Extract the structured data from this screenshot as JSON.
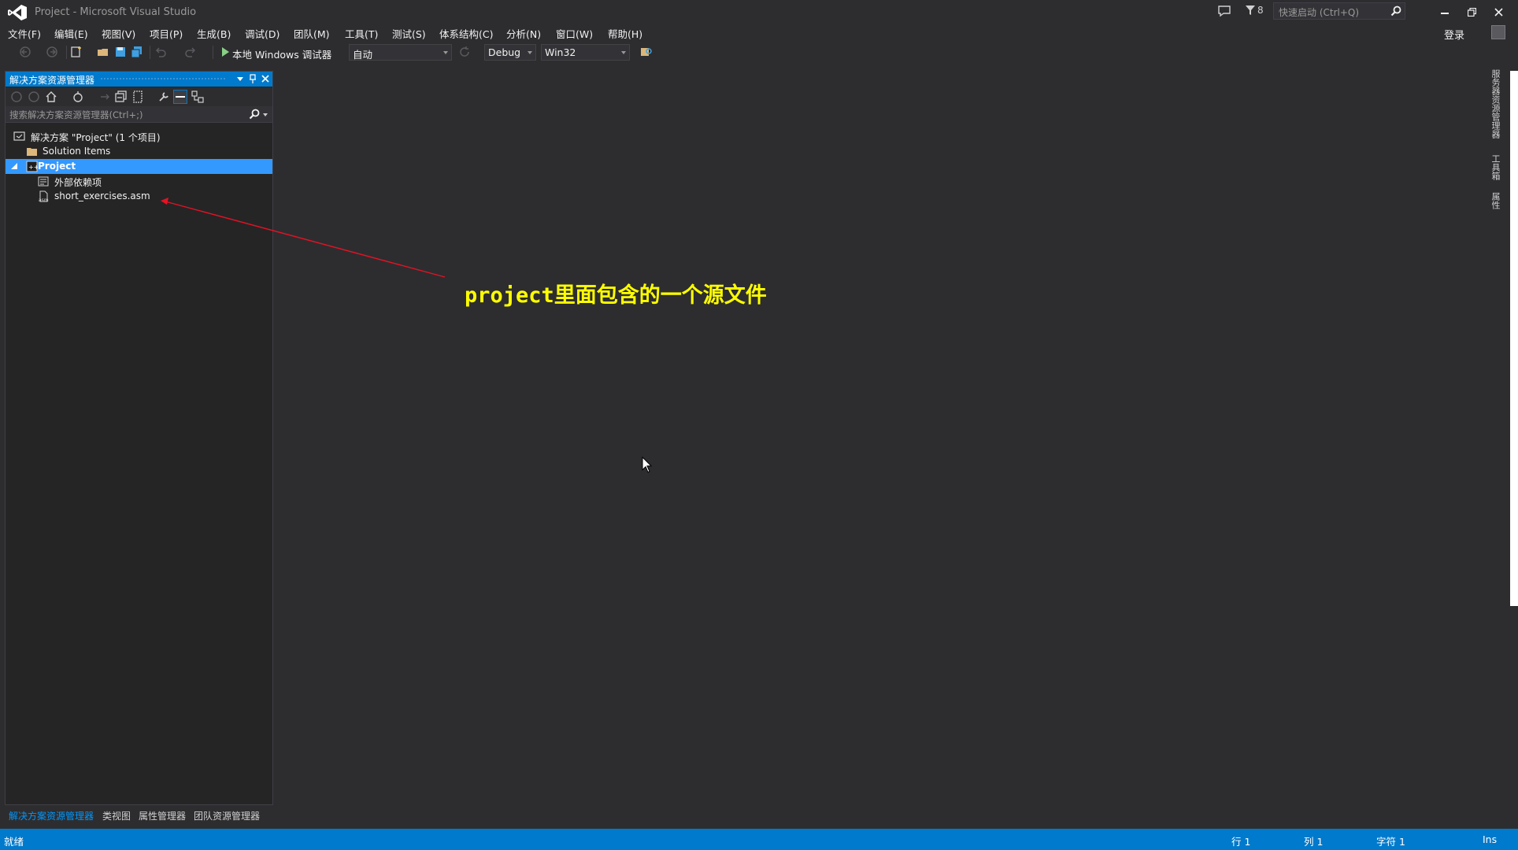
{
  "window": {
    "title": "Project - Microsoft Visual Studio",
    "notification_count": "8",
    "quick_launch_placeholder": "快速启动 (Ctrl+Q)",
    "signin_label": "登录"
  },
  "menu": {
    "items": [
      "文件(F)",
      "编辑(E)",
      "视图(V)",
      "项目(P)",
      "生成(B)",
      "调试(D)",
      "团队(M)",
      "工具(T)",
      "测试(S)",
      "体系结构(C)",
      "分析(N)",
      "窗口(W)",
      "帮助(H)"
    ]
  },
  "toolbar": {
    "debugger_label": "本地 Windows 调试器",
    "mode_value": "自动",
    "config_value": "Debug",
    "platform_value": "Win32"
  },
  "solution_explorer": {
    "title": "解决方案资源管理器",
    "search_placeholder": "搜索解决方案资源管理器(Ctrl+;)",
    "tree": {
      "solution": "解决方案 \"Project\" (1 个项目)",
      "solution_items": "Solution Items",
      "project": "Project",
      "external_deps": "外部依赖项",
      "source_file": "short_exercises.asm"
    },
    "selected_item": "Project"
  },
  "bottom_tabs": [
    "解决方案资源管理器",
    "类视图",
    "属性管理器",
    "团队资源管理器"
  ],
  "right_tabs": [
    "服务器资源管理器",
    "工具箱",
    "属性"
  ],
  "annotation": {
    "text": "project里面包含的一个源文件",
    "color": "#ffff00",
    "arrow_color": "#e81123"
  },
  "statusbar": {
    "status": "就绪",
    "line": "行 1",
    "column": "列 1",
    "char": "字符 1",
    "mode": "Ins"
  },
  "colors": {
    "accent": "#007acc",
    "selection": "#3399ff",
    "background": "#2d2d30"
  }
}
